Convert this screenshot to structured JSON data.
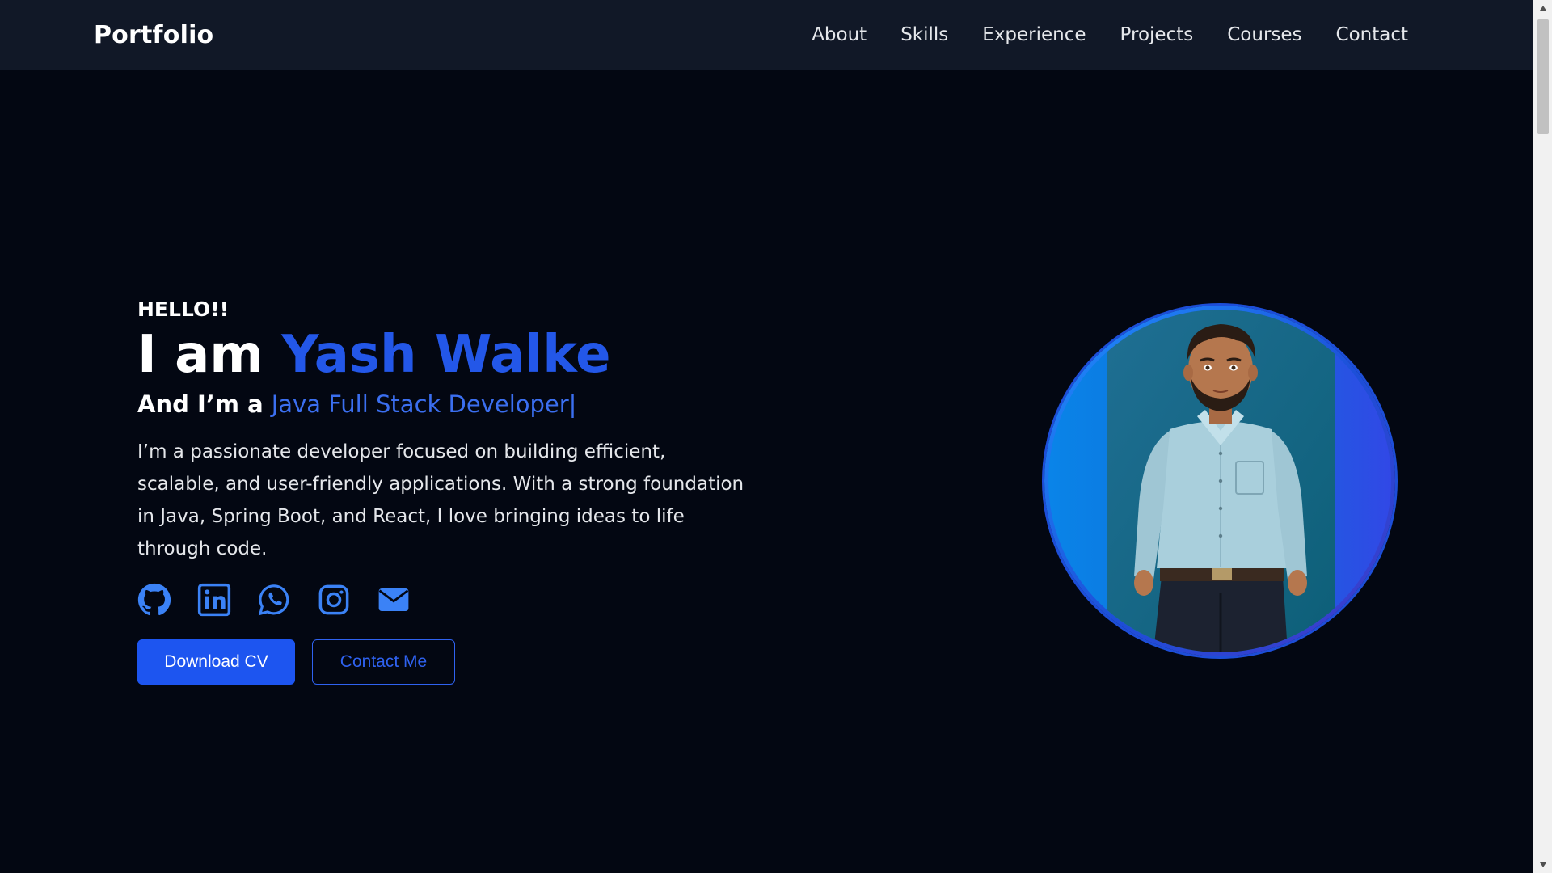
{
  "nav": {
    "brand": "Portfolio",
    "links": [
      {
        "label": "About"
      },
      {
        "label": "Skills"
      },
      {
        "label": "Experience"
      },
      {
        "label": "Projects"
      },
      {
        "label": "Courses"
      },
      {
        "label": "Contact"
      }
    ]
  },
  "hero": {
    "greeting": "HELLO!!",
    "intro_prefix": "I am ",
    "name": "Yash Walke",
    "role_prefix": "And I’m a ",
    "role": "Java Full Stack Developer",
    "cursor": "|",
    "bio": "I’m a passionate developer focused on building efficient, scalable, and user-friendly applications. With a strong foundation in Java, Spring Boot, and React, I love bringing ideas to life through code.",
    "socials": [
      {
        "icon": "github-icon"
      },
      {
        "icon": "linkedin-icon"
      },
      {
        "icon": "whatsapp-icon"
      },
      {
        "icon": "instagram-icon"
      },
      {
        "icon": "mail-icon"
      }
    ],
    "buttons": {
      "download_cv": "Download CV",
      "contact_me": "Contact Me"
    }
  },
  "colors": {
    "background": "#030712",
    "navbar": "#111827",
    "accent": "#1d55f0",
    "text": "#ffffff"
  }
}
